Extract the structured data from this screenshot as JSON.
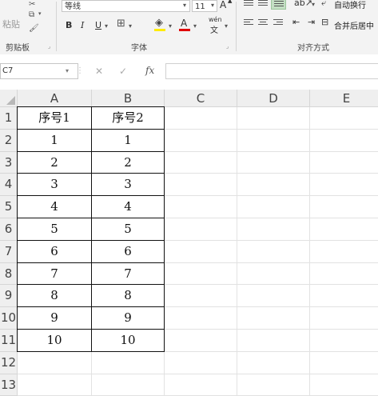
{
  "ribbon": {
    "clipboard": {
      "paste_label": "粘贴",
      "group_label": "剪贴板"
    },
    "font": {
      "font_name": "等线",
      "font_size": "11",
      "bold": "B",
      "italic": "I",
      "underline": "U",
      "grow": "A",
      "shrink": "A",
      "font_color": "A",
      "phonetic": "wén",
      "group_label": "字体"
    },
    "alignment": {
      "wrap_text": "自动换行",
      "merge_center": "合并后居中",
      "group_label": "对齐方式"
    }
  },
  "formula_bar": {
    "name_box": "C7",
    "cancel": "✕",
    "enter": "✓",
    "fx": "fx",
    "value": ""
  },
  "sheet": {
    "columns": [
      "A",
      "B",
      "C",
      "D",
      "E"
    ],
    "rows": [
      "1",
      "2",
      "3",
      "4",
      "5",
      "6",
      "7",
      "8",
      "9",
      "10",
      "11",
      "12",
      "13"
    ],
    "table": [
      [
        "序号1",
        "序号2"
      ],
      [
        "1",
        "1"
      ],
      [
        "2",
        "2"
      ],
      [
        "3",
        "3"
      ],
      [
        "4",
        "4"
      ],
      [
        "5",
        "5"
      ],
      [
        "6",
        "6"
      ],
      [
        "7",
        "7"
      ],
      [
        "8",
        "8"
      ],
      [
        "9",
        "9"
      ],
      [
        "10",
        "10"
      ]
    ]
  }
}
